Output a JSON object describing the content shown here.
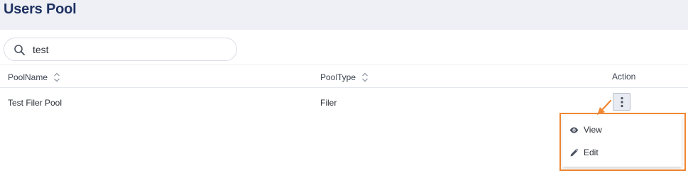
{
  "page": {
    "title": "Users Pool"
  },
  "search": {
    "value": "test",
    "placeholder": ""
  },
  "table": {
    "columns": [
      {
        "label": "PoolName"
      },
      {
        "label": "PoolType"
      },
      {
        "label": "Action"
      }
    ],
    "rows": [
      {
        "pool_name": "Test Filer Pool",
        "pool_type": "Filer"
      }
    ]
  },
  "action_menu": {
    "items": [
      {
        "label": "View",
        "icon": "eye-icon"
      },
      {
        "label": "Edit",
        "icon": "pencil-icon"
      }
    ]
  },
  "colors": {
    "title": "#1f3263",
    "header_bg": "#eef0f5",
    "highlight": "#ef8733"
  }
}
